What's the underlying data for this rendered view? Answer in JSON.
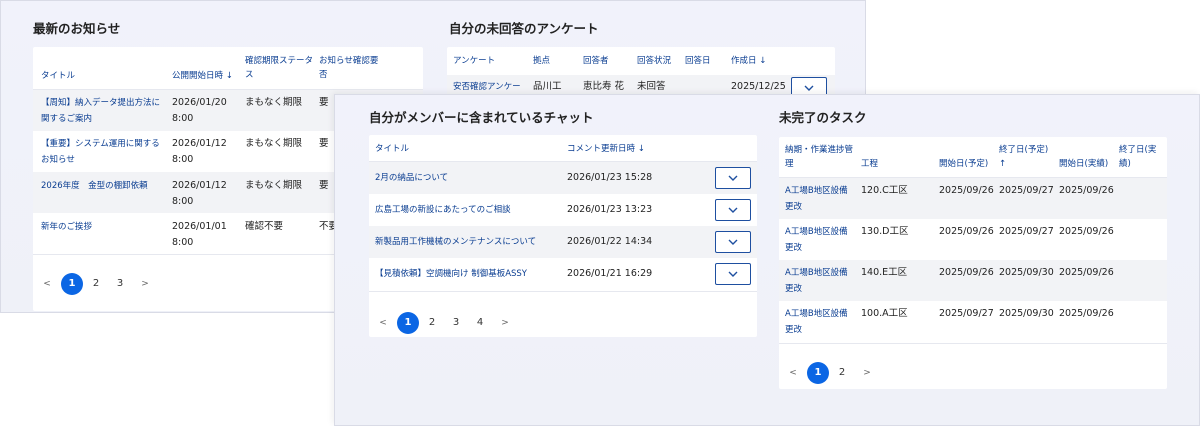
{
  "notices": {
    "title": "最新のお知らせ",
    "headers": [
      "タイトル",
      "公開開始日時 ↓",
      "確認期限ステータス",
      "お知らせ確認要否"
    ],
    "rows": [
      {
        "title": "【周知】納入データ提出方法に関するご案内",
        "date": "2026/01/20",
        "time": "8:00",
        "status": "まもなく期限",
        "need": "要"
      },
      {
        "title": "【重要】システム運用に関するお知らせ",
        "date": "2026/01/12",
        "time": "8:00",
        "status": "まもなく期限",
        "need": "要"
      },
      {
        "title": "2026年度　金型の棚卸依頼",
        "date": "2026/01/12",
        "time": "8:00",
        "status": "まもなく期限",
        "need": "要"
      },
      {
        "title": "新年のご挨拶",
        "date": "2026/01/01",
        "time": "8:00",
        "status": "確認不要",
        "need": "不要"
      }
    ],
    "pagination": {
      "prev": "<",
      "pages": [
        "1",
        "2",
        "3"
      ],
      "next": ">"
    }
  },
  "surveys": {
    "title": "自分の未回答のアンケート",
    "headers": [
      "アンケート",
      "拠点",
      "回答者",
      "回答状況",
      "回答日",
      "作成日 ↓"
    ],
    "row": {
      "survey": "安否確認アンケー",
      "site": "品川工",
      "respondent": "恵比寿 花",
      "status": "未回答",
      "created": "2025/12/25"
    }
  },
  "chats": {
    "title": "自分がメンバーに含まれているチャット",
    "headers": [
      "タイトル",
      "コメント更新日時 ↓"
    ],
    "rows": [
      {
        "title": "2月の納品について",
        "updated": "2026/01/23 15:28"
      },
      {
        "title": "広島工場の新設にあたってのご相談",
        "updated": "2026/01/23 13:23"
      },
      {
        "title": "新製品用工作機械のメンテナンスについて",
        "updated": "2026/01/22 14:34"
      },
      {
        "title": "【見積依頼】空調機向け 制御基板ASSY",
        "updated": "2026/01/21 16:29"
      }
    ],
    "pagination": {
      "prev": "<",
      "pages": [
        "1",
        "2",
        "3",
        "4"
      ],
      "next": ">"
    }
  },
  "tasks": {
    "title": "未完了のタスク",
    "headers": [
      "納期・作業進捗管理",
      "工程",
      "開始日(予定)",
      "終了日(予定) ↑",
      "開始日(実績)",
      "終了日(実績)"
    ],
    "rows": [
      {
        "name": "A工場B地区設備更改",
        "process": "120.C工区",
        "start_plan": "2025/09/26",
        "end_plan": "2025/09/27",
        "start_actual": "2025/09/26"
      },
      {
        "name": "A工場B地区設備更改",
        "process": "130.D工区",
        "start_plan": "2025/09/26",
        "end_plan": "2025/09/27",
        "start_actual": "2025/09/26"
      },
      {
        "name": "A工場B地区設備更改",
        "process": "140.E工区",
        "start_plan": "2025/09/26",
        "end_plan": "2025/09/30",
        "start_actual": "2025/09/26"
      },
      {
        "name": "A工場B地区設備更改",
        "process": "100.A工区",
        "start_plan": "2025/09/27",
        "end_plan": "2025/09/30",
        "start_actual": "2025/09/26"
      }
    ],
    "pagination": {
      "prev": "<",
      "pages": [
        "1",
        "2"
      ],
      "next": ">"
    }
  },
  "colors": {
    "accent": "#0b66e4",
    "link": "#0a3d91",
    "panel_bg": "#f1f2fb"
  }
}
